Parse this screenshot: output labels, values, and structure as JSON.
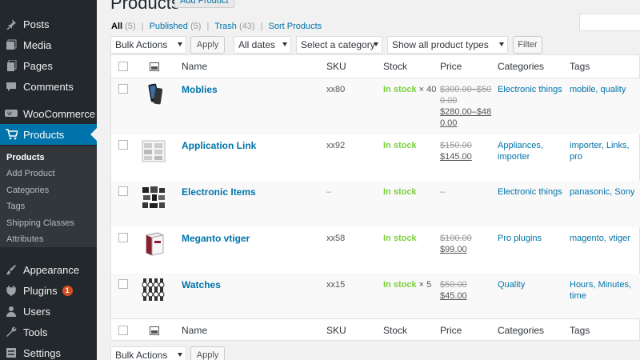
{
  "sidebar": {
    "items": [
      {
        "label": "Posts",
        "icon": "pin-icon"
      },
      {
        "label": "Media",
        "icon": "media-icon"
      },
      {
        "label": "Pages",
        "icon": "pages-icon"
      },
      {
        "label": "Comments",
        "icon": "comment-icon"
      },
      {
        "label": "WooCommerce",
        "icon": "woocommerce-icon"
      },
      {
        "label": "Products",
        "icon": "cart-icon"
      },
      {
        "label": "Appearance",
        "icon": "brush-icon"
      },
      {
        "label": "Plugins",
        "icon": "plug-icon",
        "badge": "1"
      },
      {
        "label": "Users",
        "icon": "user-icon"
      },
      {
        "label": "Tools",
        "icon": "wrench-icon"
      },
      {
        "label": "Settings",
        "icon": "settings-icon"
      }
    ],
    "submenu": [
      "Products",
      "Add Product",
      "Categories",
      "Tags",
      "Shipping Classes",
      "Attributes"
    ]
  },
  "header": {
    "title": "Products",
    "add_button": "Add Product"
  },
  "filters": {
    "all": "All",
    "all_count": "(5)",
    "published": "Published",
    "published_count": "(5)",
    "trash": "Trash",
    "trash_count": "(43)",
    "sort": "Sort Products",
    "sep": "|"
  },
  "toolbar": {
    "bulk_actions": "Bulk Actions",
    "apply": "Apply",
    "dates": "All dates",
    "category": "Select a category",
    "product_types": "Show all product types",
    "filter": "Filter"
  },
  "table": {
    "columns": [
      "Name",
      "SKU",
      "Stock",
      "Price",
      "Categories",
      "Tags"
    ],
    "rows": [
      {
        "name": "Moblies",
        "sku": "xx80",
        "stock": "In stock",
        "qty": " × 40",
        "price_old": [
          "$300.00–$50",
          "0.00"
        ],
        "price_new": [
          "$280.00–$48",
          "0.00"
        ],
        "categories": [
          "Electronic things"
        ],
        "tags": [
          "mobile, quality"
        ]
      },
      {
        "name": "Application Link",
        "sku": "xx92",
        "stock": "In stock",
        "qty": "",
        "price_old": [
          "$150.00"
        ],
        "price_new": [
          "$145.00"
        ],
        "categories": [
          "Appliances,",
          "importer"
        ],
        "tags": [
          "importer, Links,",
          "pro"
        ]
      },
      {
        "name": "Electronic Items",
        "sku": "–",
        "stock": "In stock",
        "qty": "",
        "price_dash": "–",
        "categories": [
          "Electronic things"
        ],
        "tags": [
          "panasonic, Sony"
        ]
      },
      {
        "name": "Meganto vtiger",
        "sku": "xx58",
        "stock": "In stock",
        "qty": "",
        "price_old": [
          "$100.00"
        ],
        "price_new": [
          "$99.00"
        ],
        "categories": [
          "Pro plugins"
        ],
        "tags": [
          "magento, vtiger"
        ]
      },
      {
        "name": "Watches",
        "sku": "xx15",
        "stock": "In stock",
        "qty": " × 5",
        "price_old": [
          "$50.00"
        ],
        "price_new": [
          "$45.00"
        ],
        "categories": [
          "Quality"
        ],
        "tags": [
          "Hours, Minutes,",
          "time"
        ]
      }
    ]
  },
  "colors": {
    "sidebar_bg": "#23282d",
    "active_bg": "#0073aa",
    "link": "#0073aa",
    "in_stock": "#7ad03a",
    "badge": "#d54e21"
  }
}
